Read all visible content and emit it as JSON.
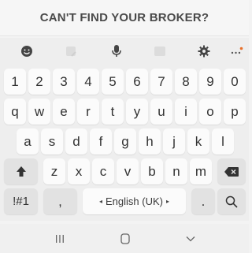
{
  "banner": {
    "text": "CAN'T FIND YOUR BROKER?"
  },
  "toolbar": {
    "icons": [
      "emoji-icon",
      "sticker-icon",
      "microphone-icon",
      "gif-icon",
      "gear-icon",
      "more-icon"
    ],
    "accent": "#e8702a"
  },
  "keyboard": {
    "row_numbers": [
      "1",
      "2",
      "3",
      "4",
      "5",
      "6",
      "7",
      "8",
      "9",
      "0"
    ],
    "row_1": [
      "q",
      "w",
      "e",
      "r",
      "t",
      "y",
      "u",
      "i",
      "o",
      "p"
    ],
    "row_2": [
      "a",
      "s",
      "d",
      "f",
      "g",
      "h",
      "j",
      "k",
      "l"
    ],
    "row_3": [
      "z",
      "x",
      "c",
      "v",
      "b",
      "n",
      "m"
    ],
    "symbols_label": "!#1",
    "comma": ",",
    "period": ".",
    "space_label": "English (UK)",
    "space_left_arrow": "◂",
    "space_right_arrow": "▸"
  },
  "navbar": {
    "icons": [
      "recent-apps-icon",
      "home-icon",
      "back-icon"
    ]
  }
}
